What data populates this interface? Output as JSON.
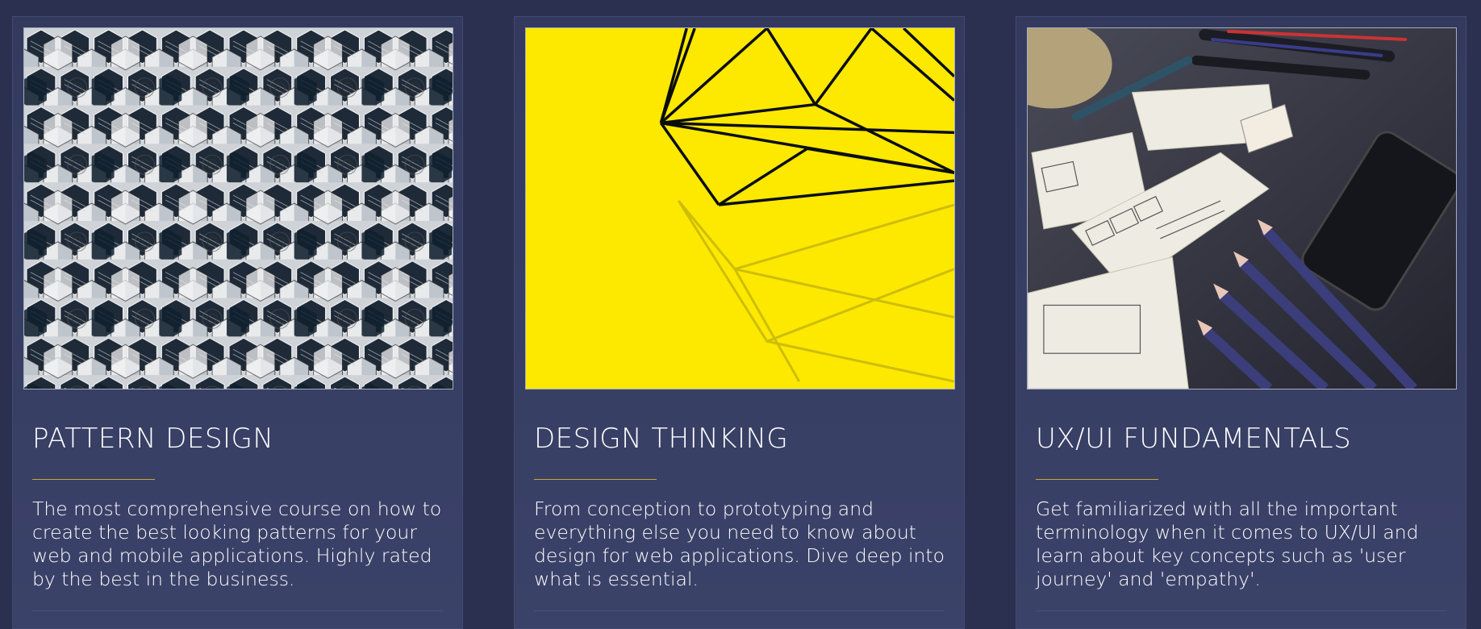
{
  "cards": [
    {
      "title": "PATTERN DESIGN",
      "description": "The most comprehensive course on how to create the best looking patterns for your web and mobile applications. Highly rated by the best in the business.",
      "image": "hexagon-pattern-tiles"
    },
    {
      "title": "DESIGN THINKING",
      "description": "From conception to prototyping and everything else you need to know about design for web applications. Dive deep into what is essential.",
      "image": "geometric-wire-on-yellow"
    },
    {
      "title": "UX/UI FUNDAMENTALS",
      "description": "Get familiarized with all the important terminology when it comes to UX/UI and learn about key concepts such as 'user journey' and 'empathy'.",
      "image": "wireframe-sketches-desk"
    }
  ],
  "colors": {
    "page_background": "#2c3050",
    "card_background": "#363d63",
    "accent_underline": "#c9a43a",
    "text": "#ffffff"
  }
}
